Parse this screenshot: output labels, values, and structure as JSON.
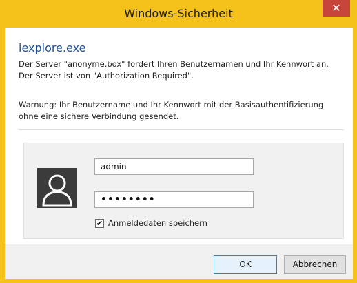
{
  "window": {
    "title": "Windows-Sicherheit",
    "close_label": "✕"
  },
  "dialog": {
    "app_name": "iexplore.exe",
    "message": "Der Server \"anonyme.box\" fordert Ihren Benutzernamen und Ihr Kennwort an. Der Server ist von \"Authorization Required\".",
    "warning": "Warnung: Ihr Benutzername und Ihr Kennwort mit der Basisauthentifizierung ohne eine sichere Verbindung gesendet."
  },
  "credentials": {
    "avatar_icon": "user-icon",
    "username_value": "admin",
    "password_value": "••••••••",
    "remember_checked": true,
    "remember_mark": "✔",
    "remember_label": "Anmeldedaten speichern"
  },
  "buttons": {
    "ok_label": "OK",
    "cancel_label": "Abbrechen"
  },
  "colors": {
    "accent_frame": "#f4c21a",
    "close_button": "#c7453a",
    "app_name": "#1b4f9c"
  }
}
